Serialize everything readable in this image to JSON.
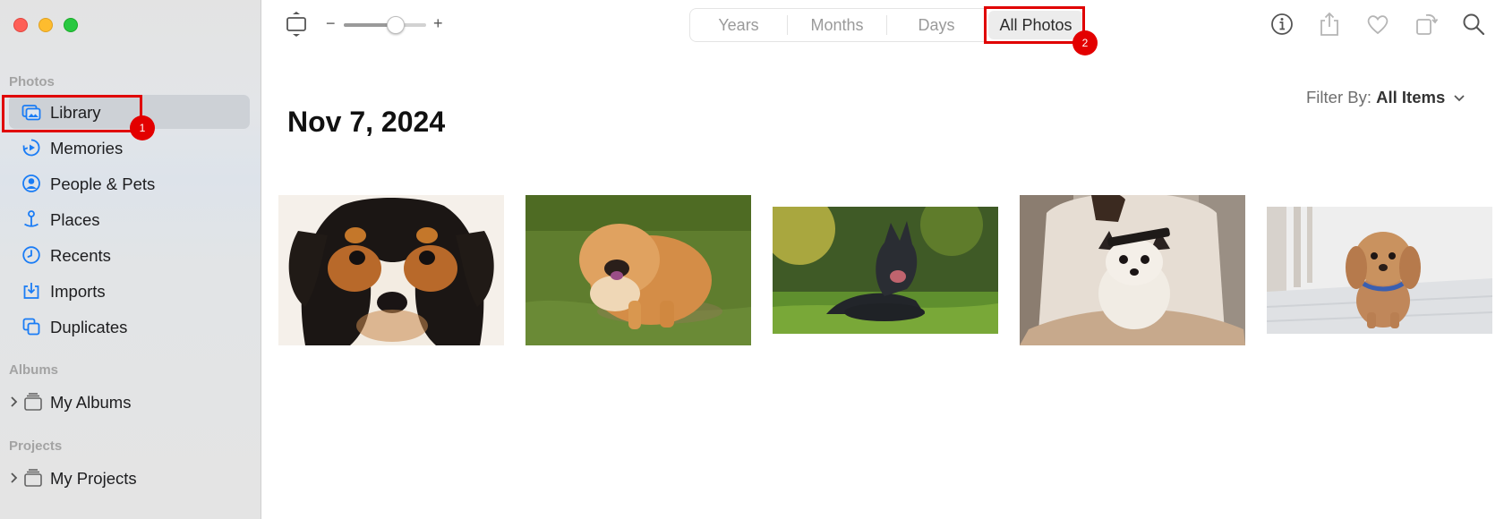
{
  "window": {
    "controls": [
      "close",
      "minimize",
      "zoom"
    ]
  },
  "sidebar": {
    "photos_section": "Photos",
    "items": [
      {
        "label": "Library",
        "icon": "library-icon",
        "selected": true
      },
      {
        "label": "Memories",
        "icon": "memories-icon"
      },
      {
        "label": "People & Pets",
        "icon": "people-icon"
      },
      {
        "label": "Places",
        "icon": "places-icon"
      },
      {
        "label": "Recents",
        "icon": "recents-icon"
      },
      {
        "label": "Imports",
        "icon": "imports-icon"
      },
      {
        "label": "Duplicates",
        "icon": "duplicates-icon"
      }
    ],
    "albums_section": "Albums",
    "albums_item": "My Albums",
    "projects_section": "Projects",
    "projects_item": "My Projects"
  },
  "toolbar": {
    "zoom_minus": "−",
    "zoom_plus": "+",
    "zoom_level": 0.6,
    "tabs": [
      "Years",
      "Months",
      "Days",
      "All Photos"
    ],
    "active_tab": "All Photos",
    "right_icons": [
      "info-icon",
      "share-icon",
      "favorite-icon",
      "rotate-icon",
      "search-icon"
    ]
  },
  "content": {
    "date_heading": "Nov 7, 2024",
    "filter_label": "Filter By:",
    "filter_value": "All Items",
    "photos": [
      {
        "subject": "puppy close-up"
      },
      {
        "subject": "chow chow on grass"
      },
      {
        "subject": "black shepherd lying in grass"
      },
      {
        "subject": "chihuahua being brushed"
      },
      {
        "subject": "cavapoo on porch"
      }
    ]
  },
  "annotations": [
    {
      "label": "1",
      "target": "Library"
    },
    {
      "label": "2",
      "target": "All Photos"
    }
  ],
  "colors": {
    "accent": "#1a7cf5",
    "highlight": "#e00000",
    "selected_row": "#cdd1d6"
  }
}
